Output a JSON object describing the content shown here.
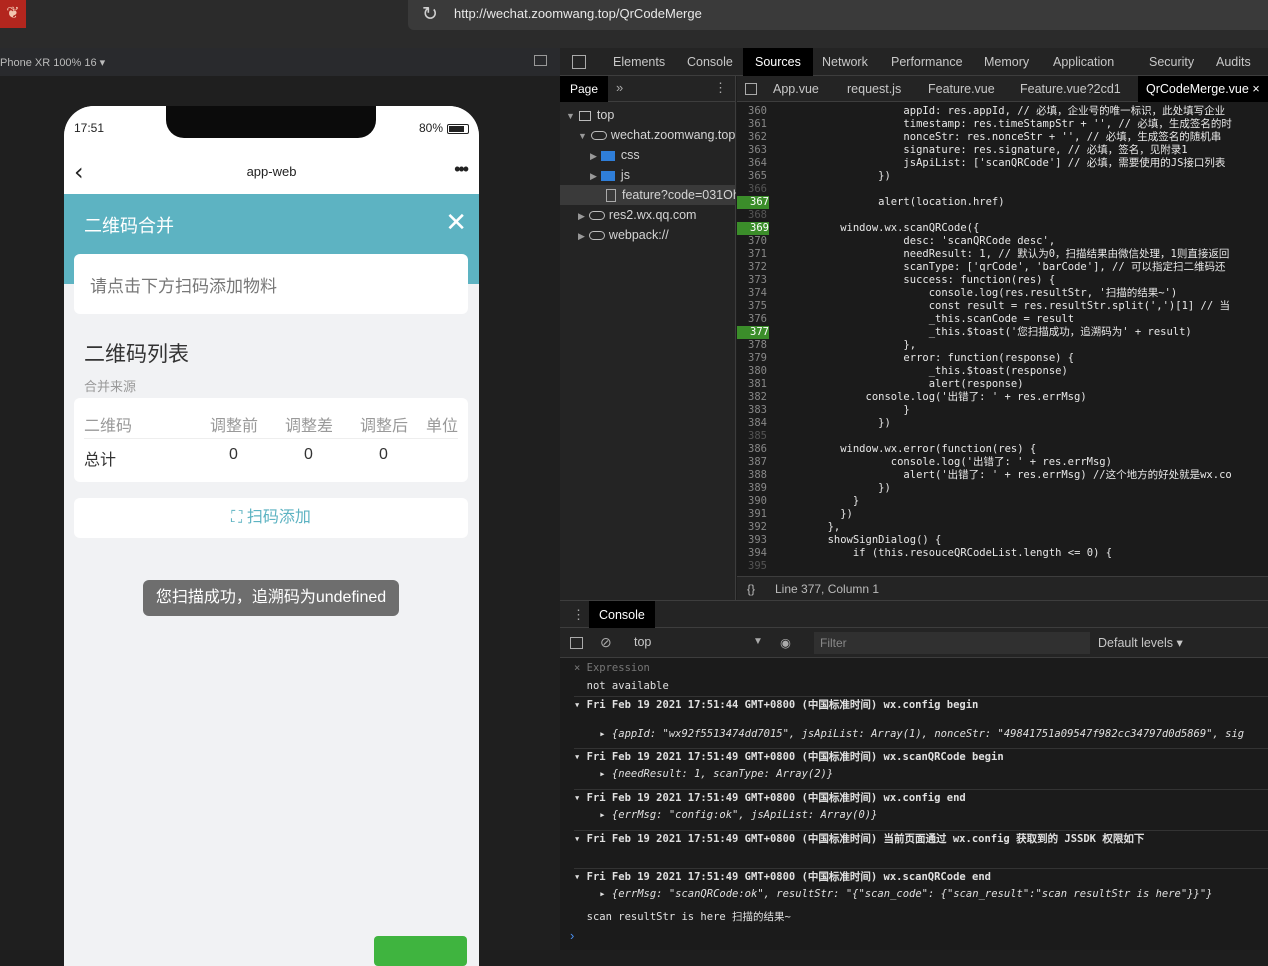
{
  "browser": {
    "app_icon": "fox-logo-icon",
    "url": "http://wechat.zoomwang.top/QrCodeMerge"
  },
  "device_bar": {
    "device": "Phone XR 100% 16 ▾"
  },
  "phone": {
    "time": "17:51",
    "battery": "80%",
    "nav_title": "app-web",
    "back": "‹",
    "more": "•••",
    "header": {
      "title": "二维码合并",
      "close": "✕"
    },
    "input_placeholder": "请点击下方扫码添加物料",
    "list_title": "二维码列表",
    "list_subtitle": "合并来源",
    "table": {
      "headers": [
        "二维码",
        "调整前",
        "调整差",
        "调整后",
        "单位"
      ],
      "row": [
        "总计",
        "0",
        "0",
        "0",
        ""
      ]
    },
    "scan_button": "扫码添加",
    "toast": "您扫描成功，追溯码为undefined"
  },
  "devtools": {
    "tabs": [
      "Elements",
      "Console",
      "Sources",
      "Network",
      "Performance",
      "Memory",
      "Application",
      "Security",
      "Audits"
    ],
    "active_tab": "Sources",
    "sidebar": {
      "tab": "Page",
      "more": "»",
      "menu": "⋮",
      "tree": [
        {
          "label": "top",
          "type": "box",
          "expanded": true
        },
        {
          "label": "wechat.zoomwang.top",
          "type": "cloud",
          "expanded": true
        },
        {
          "label": "css",
          "type": "folder",
          "expanded": false
        },
        {
          "label": "js",
          "type": "folder",
          "expanded": false
        },
        {
          "label": "feature?code=031Oh",
          "type": "doc",
          "selected": true
        },
        {
          "label": "res2.wx.qq.com",
          "type": "cloud",
          "expanded": false
        },
        {
          "label": "webpack://",
          "type": "cloud",
          "expanded": false
        }
      ]
    },
    "file_tabs": [
      "App.vue",
      "request.js",
      "Feature.vue",
      "Feature.vue?2cd1",
      "QrCodeMerge.vue"
    ],
    "active_file": "QrCodeMerge.vue",
    "file_close": "×",
    "code_lines": [
      {
        "n": "360",
        "t": "                    appId: res.appId, // 必填，企业号的唯一标识，此处填写企业"
      },
      {
        "n": "361",
        "t": "                    timestamp: res.timeStampStr + '', // 必填，生成签名的时"
      },
      {
        "n": "362",
        "t": "                    nonceStr: res.nonceStr + '', // 必填，生成签名的随机串"
      },
      {
        "n": "363",
        "t": "                    signature: res.signature, // 必填，签名，见附录1"
      },
      {
        "n": "364",
        "t": "                    jsApiList: ['scanQRCode'] // 必填，需要使用的JS接口列表"
      },
      {
        "n": "365",
        "t": "                })"
      },
      {
        "n": "366",
        "t": ""
      },
      {
        "n": "367",
        "t": "                alert(location.href)",
        "bp": true
      },
      {
        "n": "368",
        "t": ""
      },
      {
        "n": "369",
        "t": "          window.wx.scanQRCode({",
        "bp": true
      },
      {
        "n": "370",
        "t": "                    desc: 'scanQRCode desc',"
      },
      {
        "n": "371",
        "t": "                    needResult: 1, // 默认为0，扫描结果由微信处理，1则直接返回"
      },
      {
        "n": "372",
        "t": "                    scanType: ['qrCode', 'barCode'], // 可以指定扫二维码还"
      },
      {
        "n": "373",
        "t": "                    success: function(res) {"
      },
      {
        "n": "374",
        "t": "                        console.log(res.resultStr, '扫描的结果~')"
      },
      {
        "n": "375",
        "t": "                        const result = res.resultStr.split(',')[1] // 当"
      },
      {
        "n": "376",
        "t": "                        _this.scanCode = result"
      },
      {
        "n": "377",
        "t": "                        _this.$toast('您扫描成功，追溯码为' + result)",
        "bp": true
      },
      {
        "n": "378",
        "t": "                    },"
      },
      {
        "n": "379",
        "t": "                    error: function(response) {"
      },
      {
        "n": "380",
        "t": "                        _this.$toast(response)"
      },
      {
        "n": "381",
        "t": "                        alert(response)"
      },
      {
        "n": "382",
        "t": "              console.log('出错了: ' + res.errMsg)"
      },
      {
        "n": "383",
        "t": "                    }"
      },
      {
        "n": "384",
        "t": "                })"
      },
      {
        "n": "385",
        "t": ""
      },
      {
        "n": "386",
        "t": "          window.wx.error(function(res) {"
      },
      {
        "n": "387",
        "t": "                  console.log('出错了: ' + res.errMsg)"
      },
      {
        "n": "388",
        "t": "                    alert('出错了: ' + res.errMsg) //这个地方的好处就是wx.co"
      },
      {
        "n": "389",
        "t": "                })"
      },
      {
        "n": "390",
        "t": "            }"
      },
      {
        "n": "391",
        "t": "          })"
      },
      {
        "n": "392",
        "t": "        },"
      },
      {
        "n": "393",
        "t": "        showSignDialog() {"
      },
      {
        "n": "394",
        "t": "            if (this.resouceQRCodeList.length <= 0) {"
      },
      {
        "n": "395",
        "t": ""
      }
    ],
    "status": {
      "braces": "{}",
      "position": "Line 377, Column 1"
    },
    "console_tab": "Console",
    "console_toolbar": {
      "context": "top",
      "filter_placeholder": "Filter",
      "levels": "Default levels ▾"
    },
    "console_rows": [
      {
        "kind": "expr",
        "t": "× Expression"
      },
      {
        "kind": "expr2",
        "t": "  not available"
      },
      {
        "kind": "cut",
        "t": "▾ Fri Feb 19 2021 17:51:44 GMT+0800 (中国标准时间) wx.config begin"
      },
      {
        "kind": "obj",
        "t": "    ▸ {appId: \"wx92f5513474dd7015\", jsApiList: Array(1), nonceStr: \"49841751a09547f982cc34797d0d5869\", sig"
      },
      {
        "kind": "group",
        "t": "▾ Fri Feb 19 2021 17:51:49 GMT+0800 (中国标准时间) wx.scanQRCode begin"
      },
      {
        "kind": "obj",
        "t": "    ▸ {needResult: 1, scanType: Array(2)}"
      },
      {
        "kind": "group",
        "t": "▾ Fri Feb 19 2021 17:51:49 GMT+0800 (中国标准时间) wx.config end"
      },
      {
        "kind": "obj",
        "t": "    ▸ {errMsg: \"config:ok\", jsApiList: Array(0)}"
      },
      {
        "kind": "group",
        "t": "▾ Fri Feb 19 2021 17:51:49 GMT+0800 (中国标准时间) 当前页面通过 wx.config 获取到的 JSSDK 权限如下"
      },
      {
        "kind": "group",
        "t": "▾ Fri Feb 19 2021 17:51:49 GMT+0800 (中国标准时间) wx.scanQRCode end"
      },
      {
        "kind": "obj",
        "t": "    ▸ {errMsg: \"scanQRCode:ok\", resultStr: \"{\"scan_code\": {\"scan_result\":\"scan resultStr is here\"}}\"}"
      },
      {
        "kind": "plain",
        "t": "  scan resultStr is here 扫描的结果~"
      }
    ],
    "prompt": "›"
  },
  "colors": {
    "accent": "#5db3c2",
    "breakpoint": "#3b8d2a",
    "string_red": "#f28b82"
  }
}
